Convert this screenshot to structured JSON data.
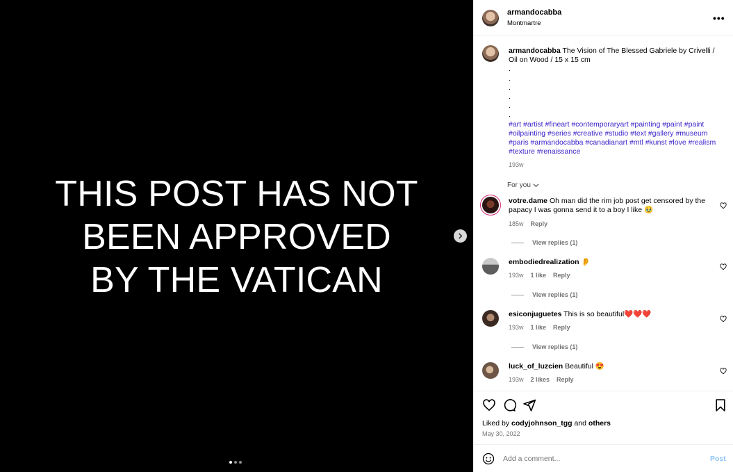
{
  "media": {
    "text_lines": [
      "THIS POST HAS NOT",
      "BEEN APPROVED",
      "BY THE VATICAN"
    ],
    "slides": {
      "count": 3,
      "current": 1
    },
    "next_icon": "chevron-right-icon"
  },
  "header": {
    "username": "armandocabba",
    "location": "Montmartre",
    "more_icon": "more-horizontal-icon",
    "more_label": "•••"
  },
  "caption": {
    "username": "armandocabba",
    "text": "The Vision of The Blessed Gabriele by Crivelli / Oil on Wood / 15 x 15 cm",
    "dots": [
      ".",
      ".",
      ".",
      ".",
      ".",
      "."
    ],
    "hashtags": "#art #artist #fineart #contemporaryart #painting #paint #paint #oilpainting #series #creative #studio #text #gallery #museum #paris #armandocabba #canadianart #mtl #kunst #love #realism #texture #renaissance",
    "time": "193w"
  },
  "for_you": "For you",
  "comments": [
    {
      "username": "votre.dame",
      "text": "Oh man did the rim job post get censored by the papacy I was gonna send it to a boy I like 🥹",
      "time": "185w",
      "likes": "",
      "reply": "Reply",
      "view_replies": "View replies (1)"
    },
    {
      "username": "embodiedrealization",
      "text": "👂",
      "time": "193w",
      "likes": "1 like",
      "reply": "Reply",
      "view_replies": "View replies (1)"
    },
    {
      "username": "esiconjuguetes",
      "text": "This is so beautiful❤️❤️❤️",
      "time": "193w",
      "likes": "1 like",
      "reply": "Reply",
      "view_replies": "View replies (1)"
    },
    {
      "username": "luck_of_luzcien",
      "text": "Beautiful 😍",
      "time": "193w",
      "likes": "2 likes",
      "reply": "Reply",
      "view_replies": ""
    }
  ],
  "actions": {
    "like_icon": "heart-icon",
    "comment_icon": "comment-icon",
    "share_icon": "share-icon",
    "save_icon": "bookmark-icon"
  },
  "likes": {
    "prefix": "Liked by",
    "user": "codyjohnson_tgg",
    "mid": "and",
    "others": "others"
  },
  "date": "May 30, 2022",
  "add_comment": {
    "placeholder": "Add a comment...",
    "post_label": "Post",
    "emoji_icon": "smiley-icon"
  },
  "colors": {
    "hashtag": "#3a24c9",
    "post_button": "#8ec5f5",
    "muted": "#737373"
  }
}
